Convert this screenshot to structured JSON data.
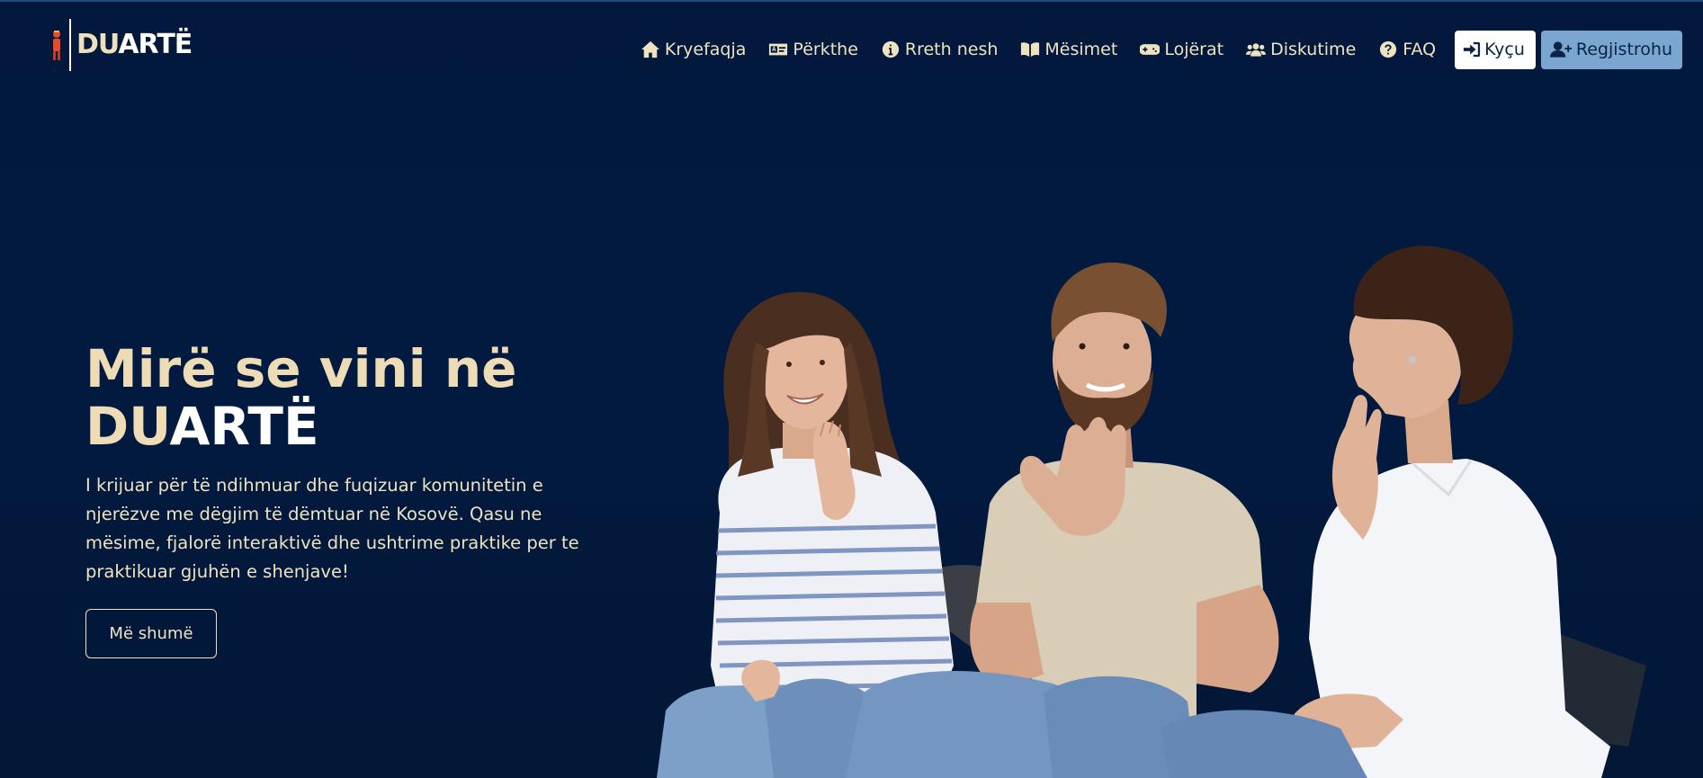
{
  "brand": {
    "name_part1": "DU",
    "name_part2": "ART",
    "name_part3": "Ë"
  },
  "nav": {
    "items": [
      {
        "label": "Kryefaqja",
        "icon": "home-icon"
      },
      {
        "label": "Përkthe",
        "icon": "id-card-icon"
      },
      {
        "label": "Rreth nesh",
        "icon": "info-circle-icon"
      },
      {
        "label": "Mësimet",
        "icon": "book-open-icon"
      },
      {
        "label": "Lojërat",
        "icon": "gamepad-icon"
      },
      {
        "label": "Diskutime",
        "icon": "users-icon"
      },
      {
        "label": "FAQ",
        "icon": "question-circle-icon"
      }
    ],
    "login_label": "Kyçu",
    "register_label": "Regjistrohu"
  },
  "hero": {
    "title_line1": "Mirë se vini në",
    "title_brand_a": "DU",
    "title_brand_b": "ARTË",
    "description": "I krijuar për të ndihmuar dhe fuqizuar komunitetin e njerëzve me dëgjim të dëmtuar në Kosovë. Qasu ne mësime, fjalorë interaktivë dhe ushtrime praktike per te praktikuar gjuhën e shenjave!",
    "more_button": "Më shumë"
  },
  "colors": {
    "background": "#021a3e",
    "accent_cream": "#eddcb6",
    "register_blue": "#7aa6cf",
    "login_white": "#ffffff"
  }
}
